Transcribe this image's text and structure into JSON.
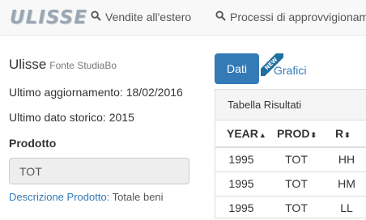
{
  "nav": {
    "logo": "ULISSE",
    "items": [
      {
        "label": "Vendite all'estero",
        "icon": "search-icon"
      },
      {
        "label": "Processi di approvvigionam",
        "icon": "search-icon"
      }
    ]
  },
  "left": {
    "title": "Ulisse",
    "subtitle": "Fonte StudiaBo",
    "last_update": "Ultimo aggiornamento: 18/02/2016",
    "last_historical": "Ultimo dato storico: 2015",
    "product_label": "Prodotto",
    "product_value": "TOT",
    "desc_link": "Descrizione Prodotto:",
    "desc_value": "Totale beni"
  },
  "tabs": {
    "dati": "Dati",
    "grafici": "Grafici",
    "new_badge": "NEW"
  },
  "table": {
    "heading": "Tabella Risultati",
    "columns": [
      {
        "label": "YEAR",
        "sort": "▲"
      },
      {
        "label": "PROD",
        "sort": "⬍"
      },
      {
        "label": "R",
        "sort": "⬍"
      }
    ],
    "rows": [
      [
        "1995",
        "TOT",
        "HH"
      ],
      [
        "1995",
        "TOT",
        "HM"
      ],
      [
        "1995",
        "TOT",
        "LL"
      ]
    ]
  },
  "colors": {
    "primary": "#337ab7",
    "navbar_bg": "#f8f8f8",
    "logo": "#9aa7b2"
  }
}
